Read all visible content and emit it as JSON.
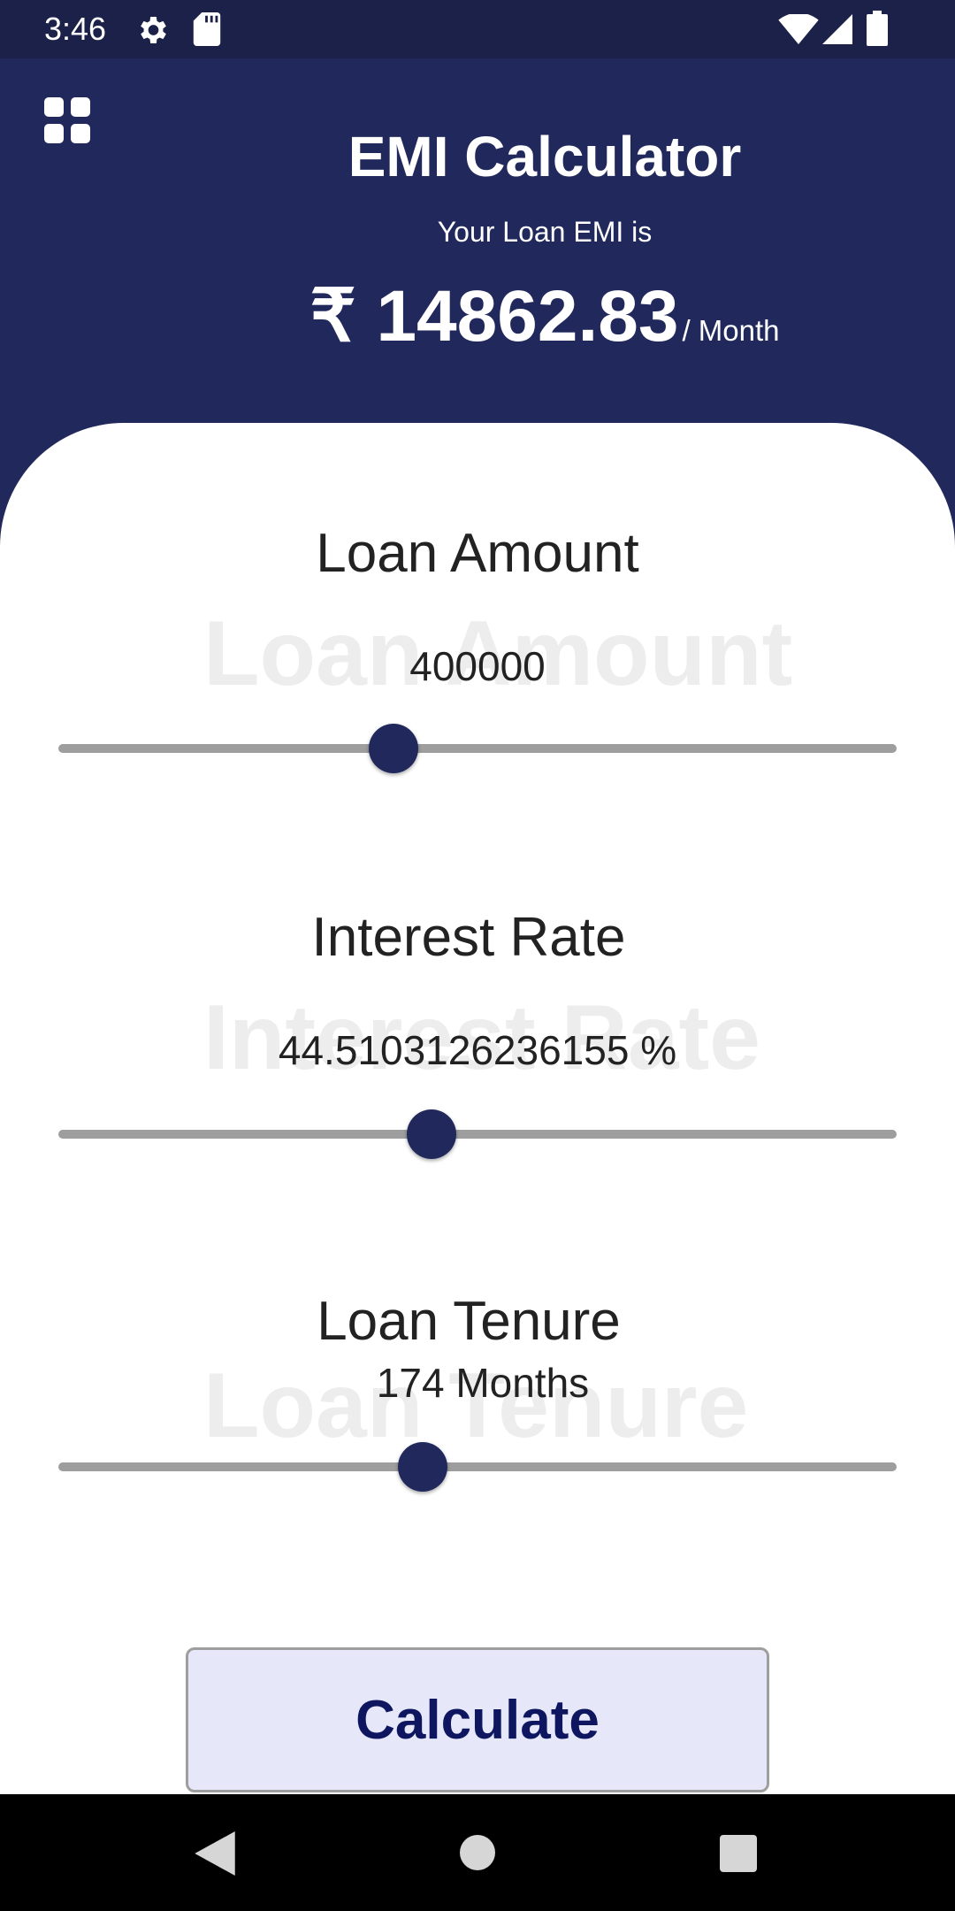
{
  "status_bar": {
    "time": "3:46",
    "icons": [
      "gear-icon",
      "sd-card-icon",
      "wifi-icon",
      "cell-signal-icon",
      "battery-icon"
    ]
  },
  "header": {
    "menu_icon": "grid-icon",
    "title": "EMI Calculator",
    "emi_caption": "Your Loan EMI is",
    "emi_value": "₹ 14862.83",
    "emi_unit": "/ Month"
  },
  "loan_amount": {
    "label": "Loan Amount",
    "ghost_label": "Loan Amount",
    "value": "400000",
    "slider_fraction": 0.4
  },
  "interest_rate": {
    "label": "Interest Rate",
    "ghost_label": "Interest Rate",
    "value": "44.5103126236155 %",
    "slider_fraction": 0.445
  },
  "loan_tenure": {
    "label": "Loan Tenure",
    "ghost_label": "Loan Tenure",
    "value": "174 Months",
    "slider_fraction": 0.435
  },
  "calculate_button": {
    "label": "Calculate"
  },
  "nav_bar": {
    "icons": [
      "back-icon",
      "home-icon",
      "recents-icon"
    ]
  },
  "colors": {
    "primary": "#21295c",
    "status_bar": "#1b2148",
    "button_bg": "#e6e8fa",
    "button_text": "#0e1660",
    "track": "#9e9e9e"
  }
}
